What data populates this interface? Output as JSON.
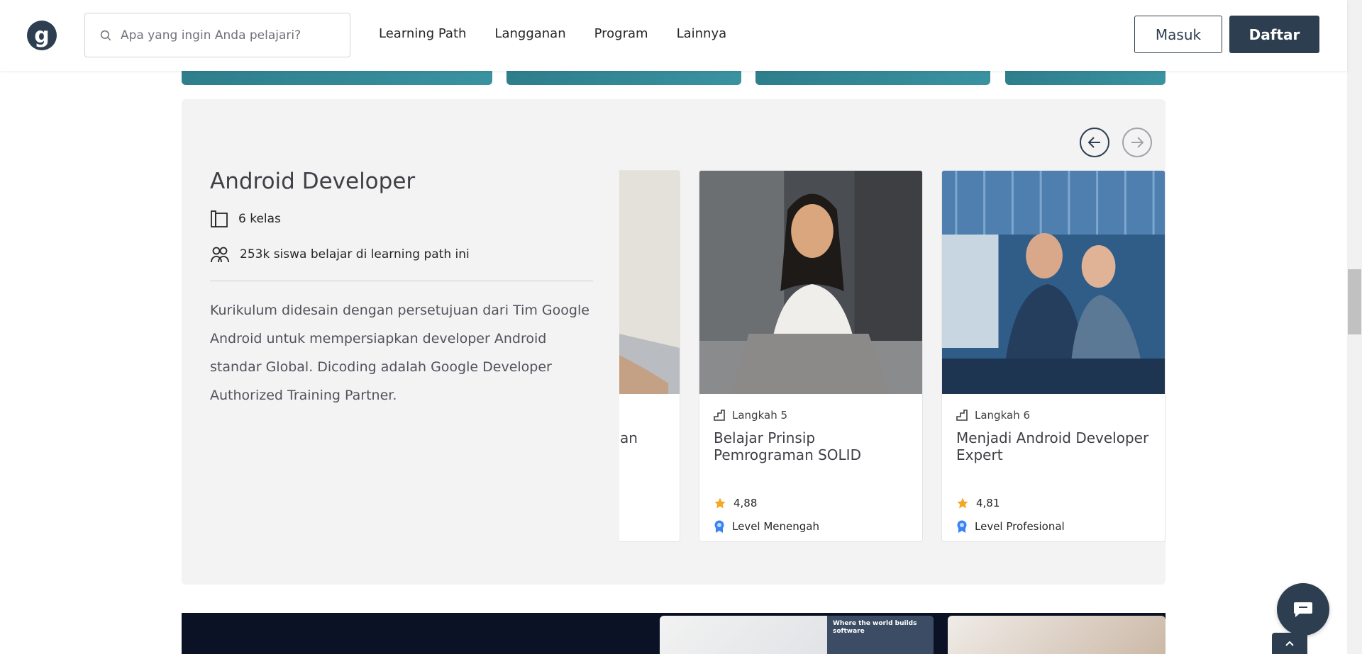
{
  "header": {
    "logo_text": "g",
    "search_placeholder": "Apa yang ingin Anda pelajari?",
    "nav": [
      "Learning Path",
      "Langganan",
      "Program",
      "Lainnya"
    ],
    "login_label": "Masuk",
    "register_label": "Daftar"
  },
  "learning_path": {
    "title": "Android Developer",
    "class_count": "6 kelas",
    "students": "253k siswa belajar di learning path ini",
    "description": "Kurikulum didesain dengan persetujuan dari Tim Google Android untuk mempersiapkan developer Android standar Global. Dicoding adalah Google Developer Authorized Training Partner.",
    "cards": [
      {
        "title_fragment": "an"
      },
      {
        "step": "Langkah 5",
        "title": "Belajar Prinsip Pemrograman SOLID",
        "rating": "4,88",
        "level": "Level Menengah"
      },
      {
        "step": "Langkah 6",
        "title": "Menjadi Android Developer Expert",
        "rating": "4,81",
        "level": "Level Profesional"
      }
    ]
  },
  "banner": {
    "thumb_text": "Where the world builds software"
  },
  "colors": {
    "primary": "#2d3e50",
    "panel_bg": "#f3f3f4",
    "star": "#f5a623",
    "level_badge": "#3b82f6"
  }
}
